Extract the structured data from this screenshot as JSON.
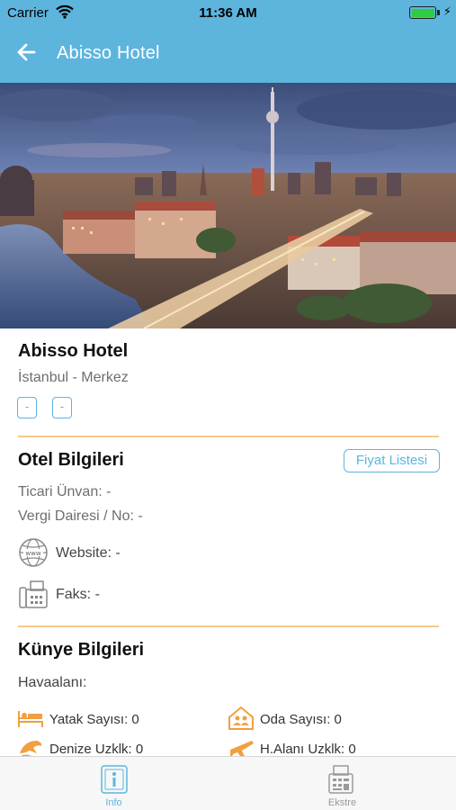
{
  "status_bar": {
    "carrier": "Carrier",
    "time": "11:36 AM",
    "battery_level": 1.0,
    "charging_glyph": "⚡"
  },
  "nav": {
    "title": "Abisso Hotel",
    "back_icon": "arrow-left-icon"
  },
  "colors": {
    "accent": "#5db5de",
    "divider": "#f7c98a",
    "feature_icon": "#f0a040",
    "muted_text": "#6e6e6e"
  },
  "hotel": {
    "name": "Abisso Hotel",
    "location": "İstanbul - Merkez",
    "chips": [
      "-",
      "-"
    ]
  },
  "hotel_info": {
    "title": "Otel Bilgileri",
    "price_list_button": "Fiyat Listesi",
    "trade_name": "Ticari Ünvan: -",
    "tax_office": "Vergi Dairesi / No: -",
    "website": "Website: -",
    "fax": "Faks: -"
  },
  "profile": {
    "title": "Künye Bilgileri",
    "airport": "Havaalanı:",
    "features": [
      {
        "icon": "bed-icon",
        "label": "Yatak Sayısı: 0"
      },
      {
        "icon": "room-icon",
        "label": "Oda Sayısı: 0"
      },
      {
        "icon": "dolphin-icon",
        "label": "Denize Uzklk: 0"
      },
      {
        "icon": "airplane-icon",
        "label": "H.Alanı Uzklk: 0"
      }
    ]
  },
  "tabs": [
    {
      "label": "Info",
      "icon": "info-icon",
      "active": true
    },
    {
      "label": "Ekstre",
      "icon": "statement-icon",
      "active": false
    }
  ]
}
